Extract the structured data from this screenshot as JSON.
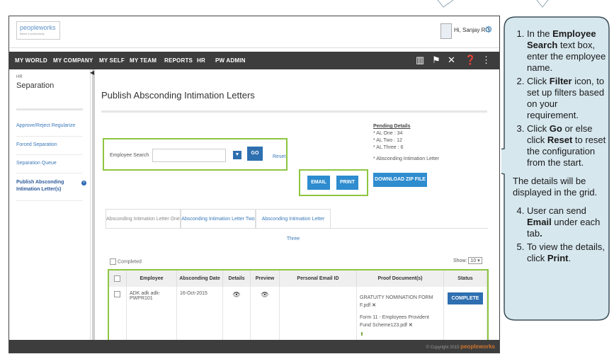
{
  "header": {
    "logo_text": "peopleworks",
    "logo_sub": "Blaze a productivity",
    "greeting": "Hi, Sanjay RO"
  },
  "nav": {
    "items": [
      "MY WORLD",
      "MY COMPANY",
      "MY SELF",
      "MY TEAM",
      "REPORTS",
      "HR",
      "PW ADMIN"
    ],
    "icons": [
      "book-icon",
      "flag-icon",
      "tools-icon",
      "help-icon",
      "network-icon"
    ]
  },
  "sidebar": {
    "section": "HR",
    "title": "Separation",
    "items": [
      {
        "label": "Approve/Reject Regularize"
      },
      {
        "label": "Forced Separation"
      },
      {
        "label": "Separation Queue"
      },
      {
        "label": "Publish Absconding Intimation Letter(s)"
      }
    ]
  },
  "main": {
    "title": "Publish Absconding Intimation Letters",
    "pending": {
      "heading": "Pending Details",
      "lines": [
        "* AL One : 34",
        "* AL Two : 12",
        "* AL Three : 6",
        "* Absconding Intimation Letter"
      ]
    },
    "search": {
      "label": "Employee Search",
      "value": "",
      "go_label": "GO",
      "reset_label": "Reset"
    },
    "actions": {
      "email": "EMAIL",
      "print": "PRINT",
      "download": "DOWNLOAD ZIP FILE"
    },
    "tabs": [
      "Absconding Intimation Letter One",
      "Absconding Intimation Letter Two",
      "Absconding Intimation Letter Three"
    ],
    "completed_label": "Completed",
    "show_label": "Show:",
    "show_value": "10",
    "table": {
      "headers": [
        "",
        "Employee",
        "Absconding Date",
        "Details",
        "Preview",
        "Personal Email ID",
        "Proof Document(s)",
        "Status"
      ],
      "row": {
        "employee": "ADK adk adk- PWPR101",
        "date": "16-Oct-2015",
        "email": "",
        "doc1": "GRATUITY NOMINATION FORM F.pdf",
        "doc2": "Form 11 - Employees Provident Fund Scheme123.pdf",
        "status_button": "COMPLETE"
      }
    }
  },
  "footer": {
    "copyright": "© Copyright 2015",
    "brand": "peopleworks"
  },
  "callout": {
    "step1_a": "In the ",
    "step1_b": "Employee Search",
    "step1_c": " text box, enter the employee name.",
    "step2_a": "Click ",
    "step2_b": "Filter",
    "step2_c": " icon, to set up filters based on your requirement.",
    "step3_a": "Click ",
    "step3_b": "Go",
    "step3_c": " or else click ",
    "step3_d": "Reset",
    "step3_e": " to reset the configuration from the start.",
    "note": "The details will be displayed in the grid.",
    "step4_a": "User can send ",
    "step4_b": "Email",
    "step4_c": " under each tab",
    "step4_d": ".",
    "step5_a": "To view the details, click ",
    "step5_b": "Print",
    "step5_c": "."
  },
  "colors": {
    "accent_blue": "#2e6fb0",
    "highlight_green": "#8dc63f",
    "callout_fill": "#d6e7ee",
    "nav_bg": "#3d3d3d"
  }
}
